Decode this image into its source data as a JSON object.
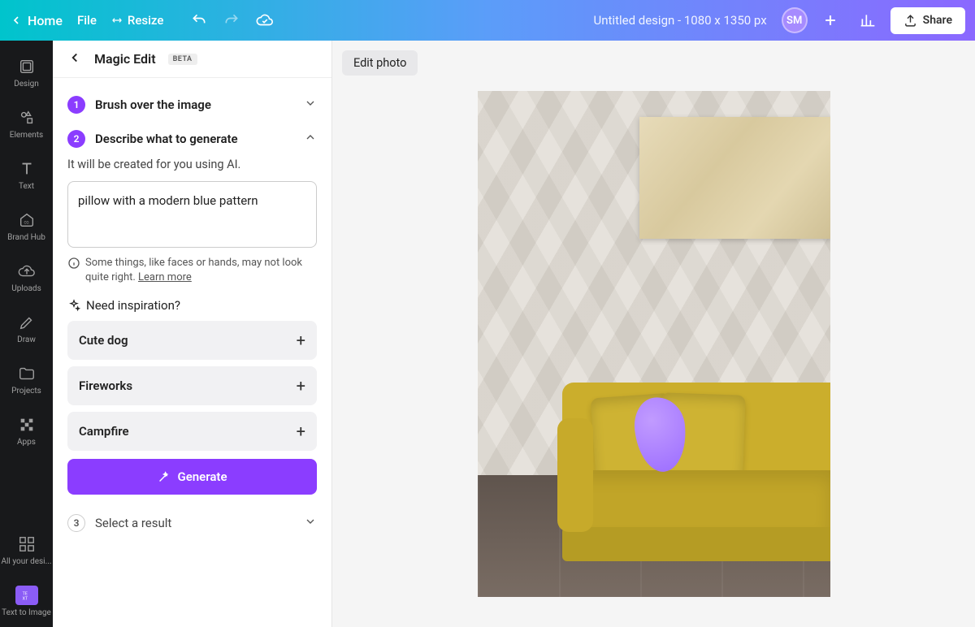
{
  "topbar": {
    "home": "Home",
    "file": "File",
    "resize": "Resize",
    "design_name": "Untitled design - 1080 x 1350 px",
    "avatar_initials": "SM",
    "share": "Share"
  },
  "rail": {
    "items": [
      {
        "label": "Design"
      },
      {
        "label": "Elements"
      },
      {
        "label": "Text"
      },
      {
        "label": "Brand Hub"
      },
      {
        "label": "Uploads"
      },
      {
        "label": "Draw"
      },
      {
        "label": "Projects"
      },
      {
        "label": "Apps"
      }
    ],
    "all_designs": "All your desi...",
    "text_to_image": "Text to Image"
  },
  "panel": {
    "title": "Magic Edit",
    "badge": "BETA",
    "step1": {
      "num": "1",
      "label": "Brush over the image"
    },
    "step2": {
      "num": "2",
      "label": "Describe what to generate",
      "desc": "It will be created for you using AI."
    },
    "prompt_value": "pillow with a modern blue pattern",
    "disclaimer_text": "Some things, like faces or hands, may not look quite right. ",
    "learn_more": "Learn more",
    "inspiration_heading": "Need inspiration?",
    "suggestions": [
      "Cute dog",
      "Fireworks",
      "Campfire"
    ],
    "generate": "Generate",
    "step3": {
      "num": "3",
      "label": "Select a result"
    }
  },
  "canvas": {
    "edit_photo": "Edit photo"
  }
}
